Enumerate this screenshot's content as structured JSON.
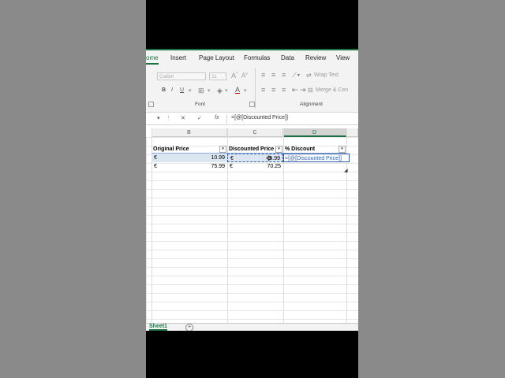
{
  "ribbon": {
    "tabs": [
      "ome",
      "Insert",
      "Page Layout",
      "Formulas",
      "Data",
      "Review",
      "View"
    ],
    "font_name": "Calibri",
    "font_size": "11",
    "wrap_text": "Wrap Text",
    "merge_center": "Merge & Cen",
    "groups": {
      "font": "Font",
      "alignment": "Alignment"
    }
  },
  "formula_bar": {
    "cancel": "✕",
    "enter": "✓",
    "fx": "fx",
    "formula": "=[@[Discounted Price]]"
  },
  "columns": [
    "B",
    "C",
    "D"
  ],
  "table": {
    "headers": [
      "Original Price",
      "Discounted Price",
      "% Discount"
    ],
    "rows": [
      {
        "cur1": "€",
        "original": "10.99",
        "cur2": "€",
        "discounted": "5.99",
        "edit": "=[@[Discounted Price]]"
      },
      {
        "cur1": "€",
        "original": "75.99",
        "cur2": "€",
        "discounted": "70.25",
        "edit": ""
      }
    ]
  },
  "sheet": {
    "name": "Sheet1",
    "add": "+"
  },
  "colors": {
    "accent": "#1e7145",
    "ref": "#2f5da9",
    "row_band": "#dce6f1"
  }
}
